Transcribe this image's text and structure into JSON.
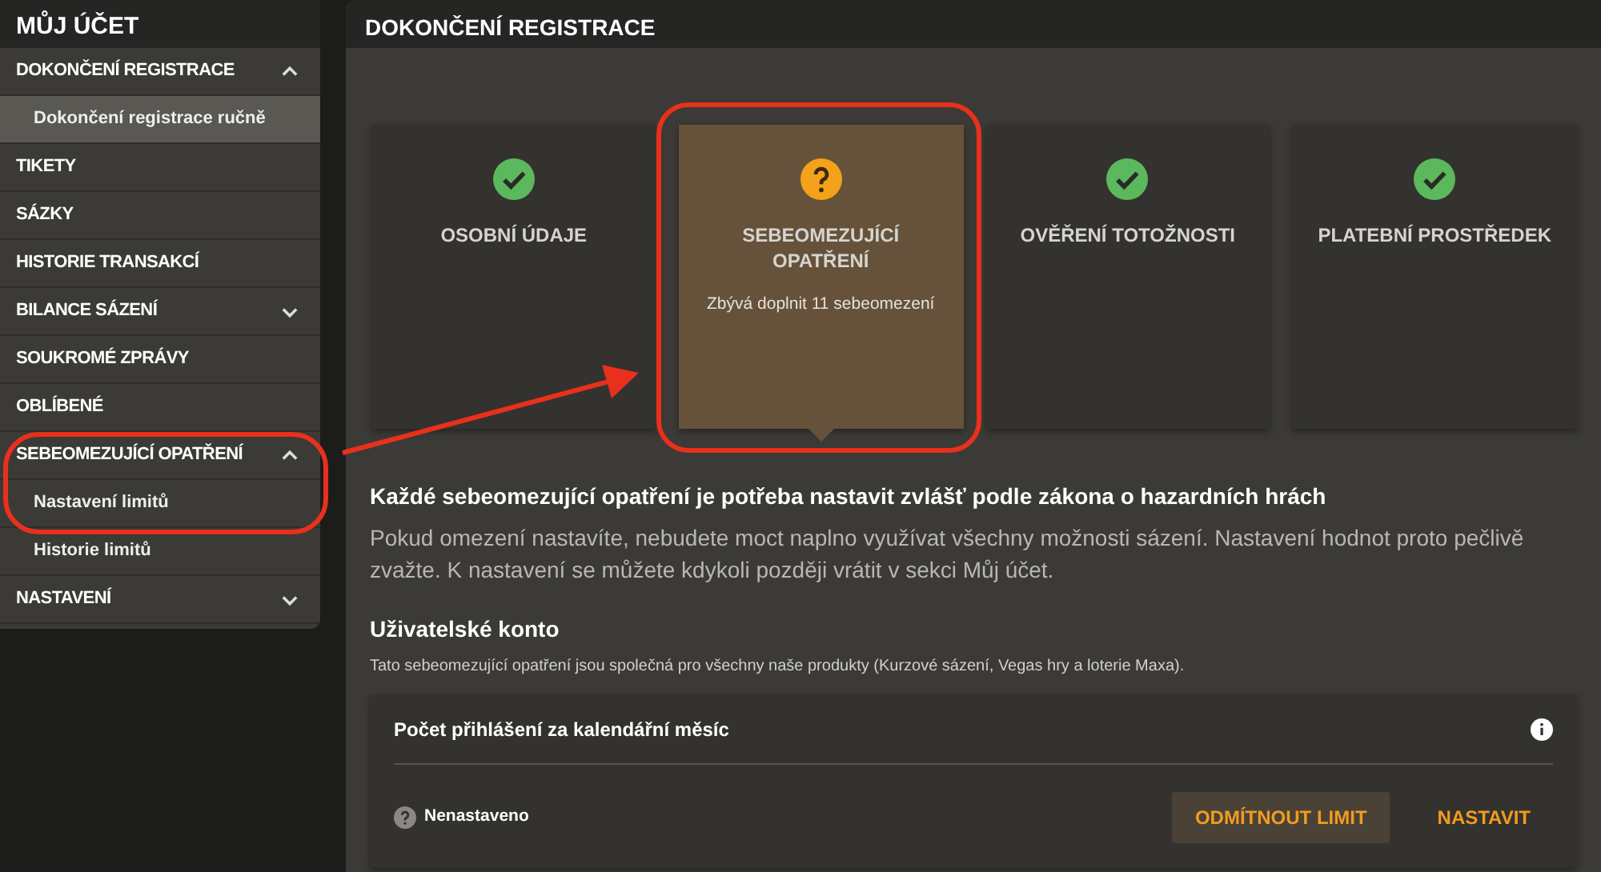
{
  "sidebar": {
    "title": "MŮJ ÚČET",
    "items": [
      {
        "label": "DOKONČENÍ REGISTRACE",
        "expanded": true,
        "children": [
          {
            "label": "Dokončení registrace ručně",
            "selected": true
          }
        ]
      },
      {
        "label": "TIKETY"
      },
      {
        "label": "SÁZKY"
      },
      {
        "label": "HISTORIE TRANSAKCÍ"
      },
      {
        "label": "BILANCE SÁZENÍ",
        "expanded": false
      },
      {
        "label": "SOUKROMÉ ZPRÁVY"
      },
      {
        "label": "OBLÍBENÉ"
      },
      {
        "label": "SEBEOMEZUJÍCÍ OPATŘENÍ",
        "expanded": true,
        "children": [
          {
            "label": "Nastavení limitů",
            "selected": false
          },
          {
            "label": "Historie limitů",
            "selected": false
          }
        ]
      },
      {
        "label": "NASTAVENÍ",
        "expanded": false
      }
    ]
  },
  "main": {
    "title": "DOKONČENÍ REGISTRACE",
    "steps": [
      {
        "title": "OSOBNÍ ÚDAJE",
        "complete": true,
        "selected": false
      },
      {
        "title": "SEBEOMEZUJÍCÍ OPATŘENÍ",
        "complete": false,
        "note": "Zbývá doplnit 11 sebeomezení",
        "selected": true
      },
      {
        "title": "OVĚŘENÍ TOTOŽNOSTI",
        "complete": true,
        "selected": false
      },
      {
        "title": "PLATEBNÍ PROSTŘEDEK",
        "complete": true,
        "selected": false
      }
    ],
    "heading": "Každé sebeomezující opatření je potřeba nastavit zvlášť podle zákona o hazardních hrách",
    "paragraph": "Pokud omezení nastavíte, nebudete moct naplno využívat všechny možnosti sázení. Nastavení hodnot proto pečlivě zvažte. K nastavení se můžete kdykoli později vrátit v sekci Můj účet.",
    "section_title": "Uživatelské konto",
    "section_note": "Tato sebeomezující opatření jsou společná pro všechny naše produkty (Kurzové sázení, Vegas hry a loterie Maxa).",
    "limit_card": {
      "title": "Počet přihlášení za kalendářní měsíc",
      "status": "Nenastaveno",
      "buttons": [
        {
          "label": "ODMÍTNOUT LIMIT",
          "kind": "filled"
        },
        {
          "label": "NASTAVIT",
          "kind": "text"
        }
      ]
    }
  }
}
